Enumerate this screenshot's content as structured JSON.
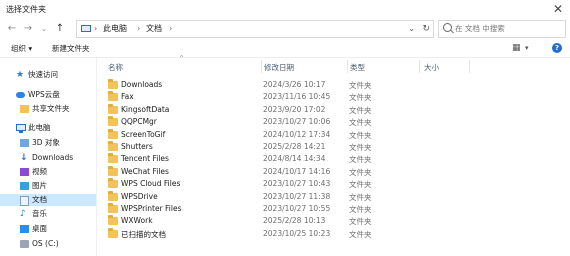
{
  "window": {
    "title": "选择文件夹"
  },
  "nav": {
    "back_icon": "arrow-left",
    "forward_icon": "arrow-right",
    "recent_icon": "chevron-down",
    "up_icon": "arrow-up",
    "breadcrumb": [
      "此电脑",
      "文档"
    ],
    "search_placeholder": "在 文档 中搜索"
  },
  "toolbar": {
    "organize": "组织 ▾",
    "new_folder": "新建文件夹"
  },
  "columns": {
    "name": "名称",
    "date": "修改日期",
    "type": "类型",
    "size": "大小"
  },
  "sidebar": {
    "items": [
      {
        "label": "快速访问",
        "icon": "star-icon"
      },
      {
        "label": "WPS云盘",
        "icon": "cloud-icon"
      },
      {
        "label": "共享文件夹",
        "icon": "shared-folder-icon"
      },
      {
        "label": "此电脑",
        "icon": "computer-icon"
      },
      {
        "label": "3D 对象",
        "icon": "3d-objects-icon"
      },
      {
        "label": "Downloads",
        "icon": "download-icon"
      },
      {
        "label": "视频",
        "icon": "video-icon"
      },
      {
        "label": "图片",
        "icon": "picture-icon"
      },
      {
        "label": "文档",
        "icon": "document-icon"
      },
      {
        "label": "音乐",
        "icon": "music-icon"
      },
      {
        "label": "桌面",
        "icon": "desktop-icon"
      },
      {
        "label": "OS (C:)",
        "icon": "drive-icon"
      }
    ]
  },
  "files": [
    {
      "name": "Downloads",
      "date": "2024/3/26 10:17",
      "type": "文件夹"
    },
    {
      "name": "Fax",
      "date": "2023/11/16 10:45",
      "type": "文件夹"
    },
    {
      "name": "KingsoftData",
      "date": "2023/9/20 17:02",
      "type": "文件夹"
    },
    {
      "name": "QQPCMgr",
      "date": "2023/10/27 10:06",
      "type": "文件夹"
    },
    {
      "name": "ScreenToGif",
      "date": "2024/10/12 17:34",
      "type": "文件夹"
    },
    {
      "name": "Shutters",
      "date": "2025/2/28 14:21",
      "type": "文件夹"
    },
    {
      "name": "Tencent Files",
      "date": "2024/8/14 14:34",
      "type": "文件夹"
    },
    {
      "name": "WeChat Files",
      "date": "2024/10/17 14:16",
      "type": "文件夹"
    },
    {
      "name": "WPS Cloud Files",
      "date": "2023/10/27 10:43",
      "type": "文件夹"
    },
    {
      "name": "WPSDrive",
      "date": "2023/10/27 11:38",
      "type": "文件夹"
    },
    {
      "name": "WPSPrinter Files",
      "date": "2023/10/27 10:55",
      "type": "文件夹"
    },
    {
      "name": "WXWork",
      "date": "2025/2/28 10:13",
      "type": "文件夹"
    },
    {
      "name": "已扫描的文档",
      "date": "2023/10/25 10:23",
      "type": "文件夹"
    }
  ],
  "colors": {
    "selected": "#cce8ff",
    "folder": "#f4c25a",
    "accent": "#1f6fd0"
  }
}
